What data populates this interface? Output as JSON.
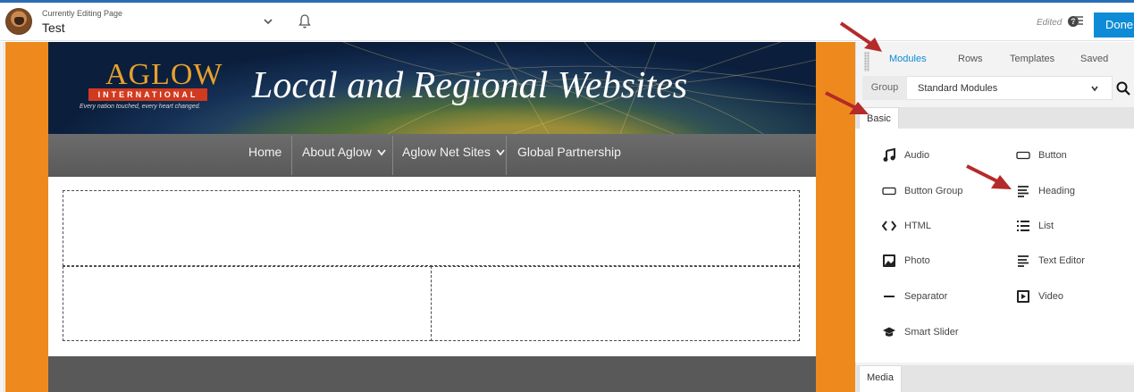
{
  "topbar": {
    "editing_label": "Currently Editing Page",
    "page_title": "Test",
    "status": "Edited",
    "done_label": "Done"
  },
  "site": {
    "logo_text": "AGLOW",
    "logo_band": "INTERNATIONAL",
    "logo_tagline": "Every nation touched, every heart changed.",
    "banner_title": "Local and Regional Websites",
    "nav": [
      {
        "label": "Home"
      },
      {
        "label": "About Aglow"
      },
      {
        "label": "Aglow Net Sites"
      },
      {
        "label": "Global Partnership"
      }
    ]
  },
  "panel": {
    "tabs": [
      "Modules",
      "Rows",
      "Templates",
      "Saved"
    ],
    "active_tab": "Modules",
    "group_label": "Group",
    "group_value": "Standard Modules",
    "section_basic": "Basic",
    "section_media": "Media",
    "modules": [
      {
        "label": "Audio",
        "icon": "music-note-icon"
      },
      {
        "label": "Button",
        "icon": "button-outline-icon"
      },
      {
        "label": "Button Group",
        "icon": "button-outline-icon"
      },
      {
        "label": "Heading",
        "icon": "text-lines-icon"
      },
      {
        "label": "HTML",
        "icon": "code-icon"
      },
      {
        "label": "List",
        "icon": "list-icon"
      },
      {
        "label": "Photo",
        "icon": "photo-icon"
      },
      {
        "label": "Text Editor",
        "icon": "text-lines-icon"
      },
      {
        "label": "Separator",
        "icon": "minus-icon"
      },
      {
        "label": "Video",
        "icon": "video-icon"
      },
      {
        "label": "Smart Slider",
        "icon": "graduation-cap-icon"
      }
    ]
  },
  "colors": {
    "accent_blue": "#0e8bd6",
    "orange": "#ee8a1d",
    "annotation_red": "#b52a2a"
  }
}
